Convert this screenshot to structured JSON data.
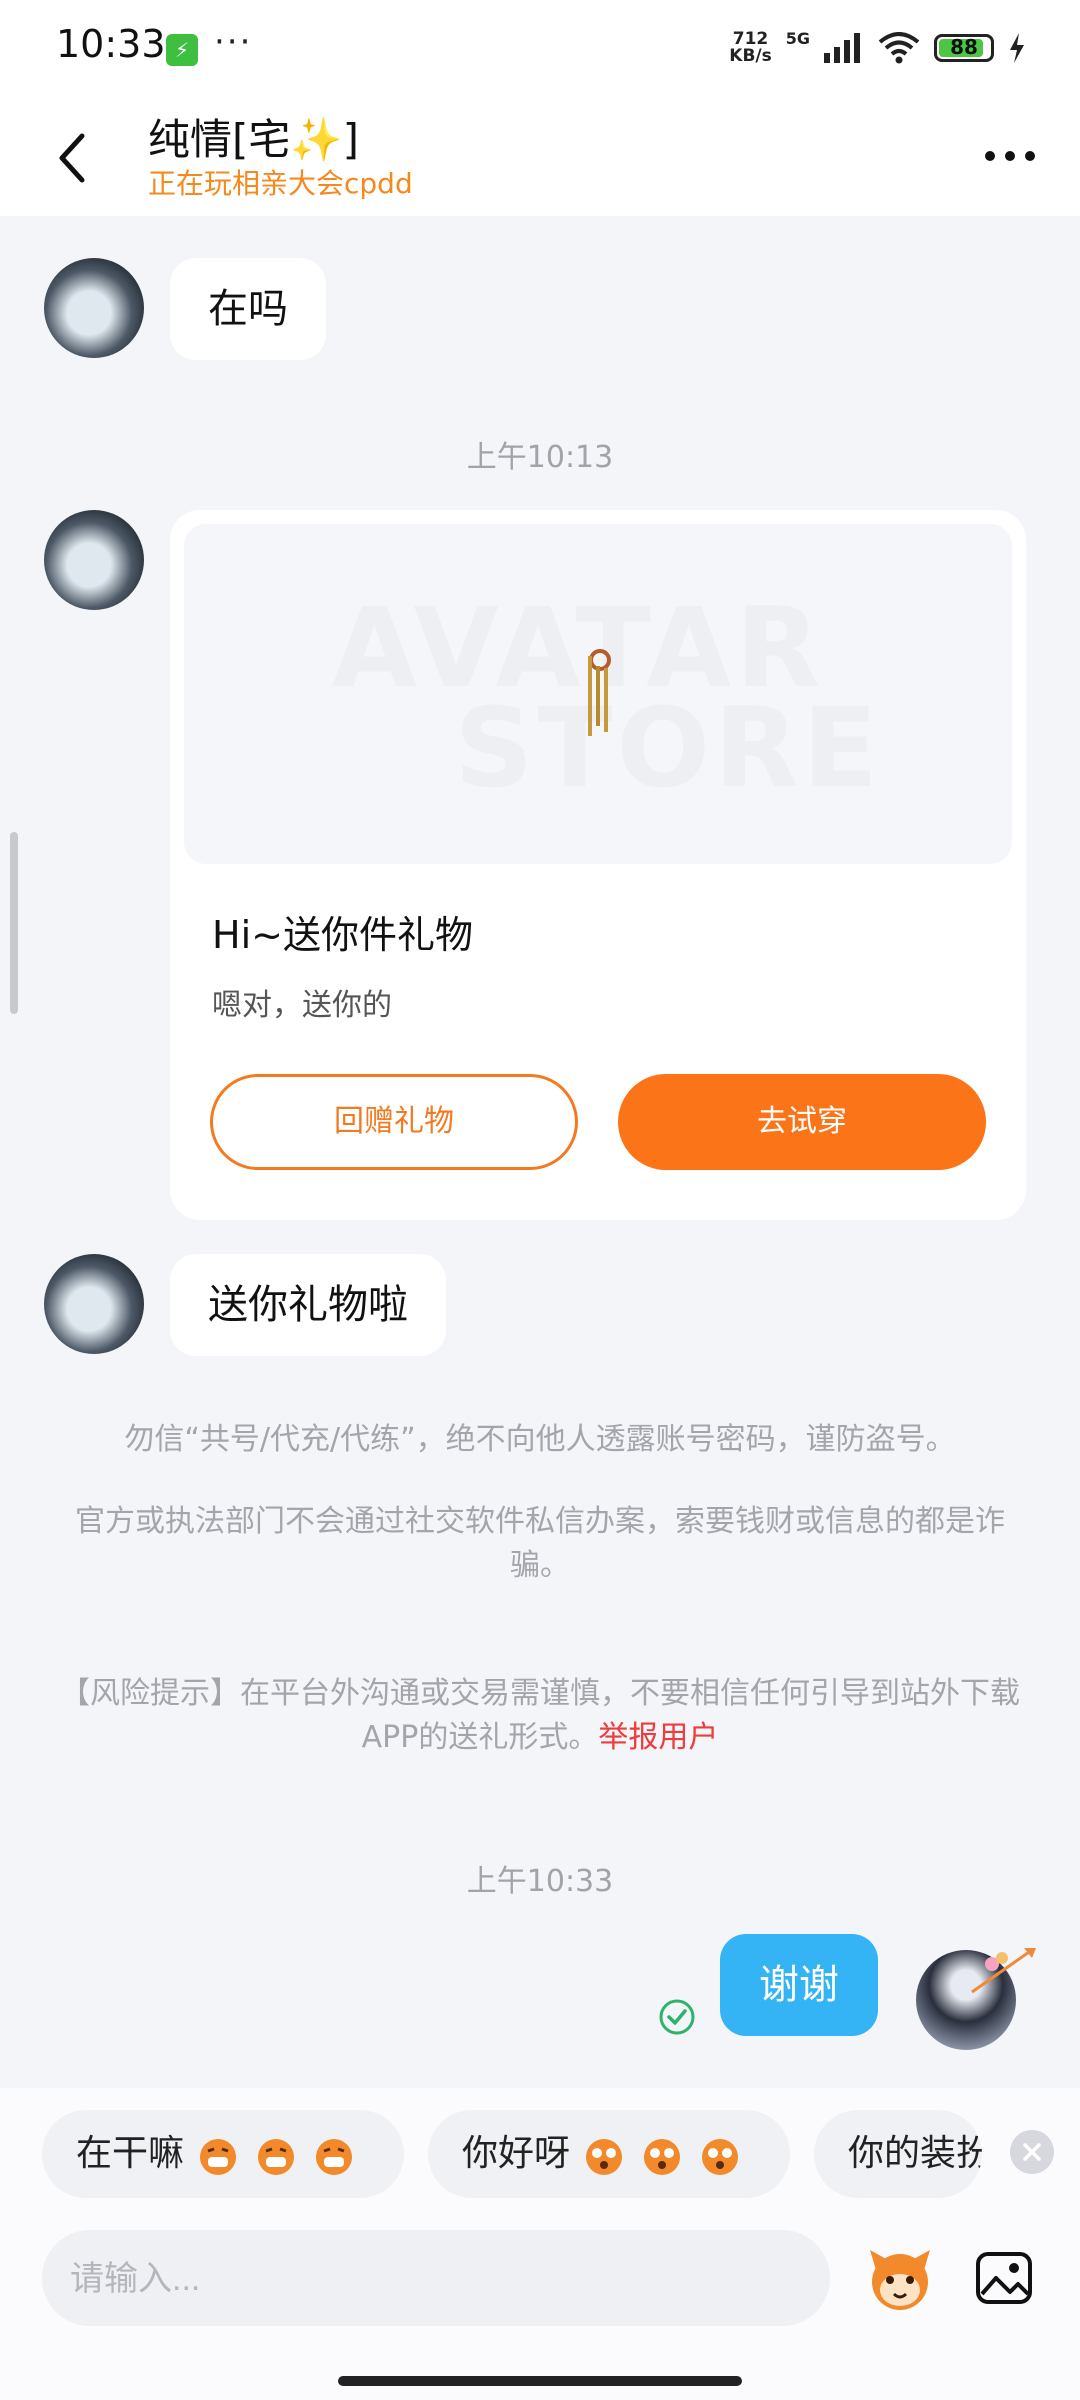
{
  "status_bar": {
    "time": "10:33",
    "dots": "···",
    "net_speed_value": "712",
    "net_speed_unit": "KB/s",
    "network": "5G",
    "battery": "88"
  },
  "header": {
    "name": "纯情[宅✨]",
    "status": "正在玩相亲大会cpdd"
  },
  "messages": {
    "m1_text": "在吗",
    "time1": "上午10:13",
    "gift_card": {
      "watermark1": "AVATAR",
      "watermark2": "STORE",
      "title": "Hi~送你件礼物",
      "subtitle": "嗯对，送你的",
      "return_gift": "回赠礼物",
      "try_on": "去试穿"
    },
    "m3_text": "送你礼物啦",
    "notice1": "勿信“共号/代充/代练”，绝不向他人透露账号密码，谨防盗号。",
    "notice2": "官方或执法部门不会通过社交软件私信办案，索要钱财或信息的都是诈骗。",
    "notice3": "【风险提示】在平台外沟通或交易需谨慎，不要相信任何引导到站外下载APP的送礼形式。",
    "report": "举报用户",
    "time2": "上午10:33",
    "my_text": "谢谢"
  },
  "quick_replies": [
    "在干嘛",
    "你好呀",
    "你的装扮"
  ],
  "input": {
    "placeholder": "请输入..."
  },
  "colors": {
    "accent": "#fb7418",
    "my_bubble": "#34b4f4",
    "status_text": "#f5891e",
    "report": "#ee3b3b"
  }
}
